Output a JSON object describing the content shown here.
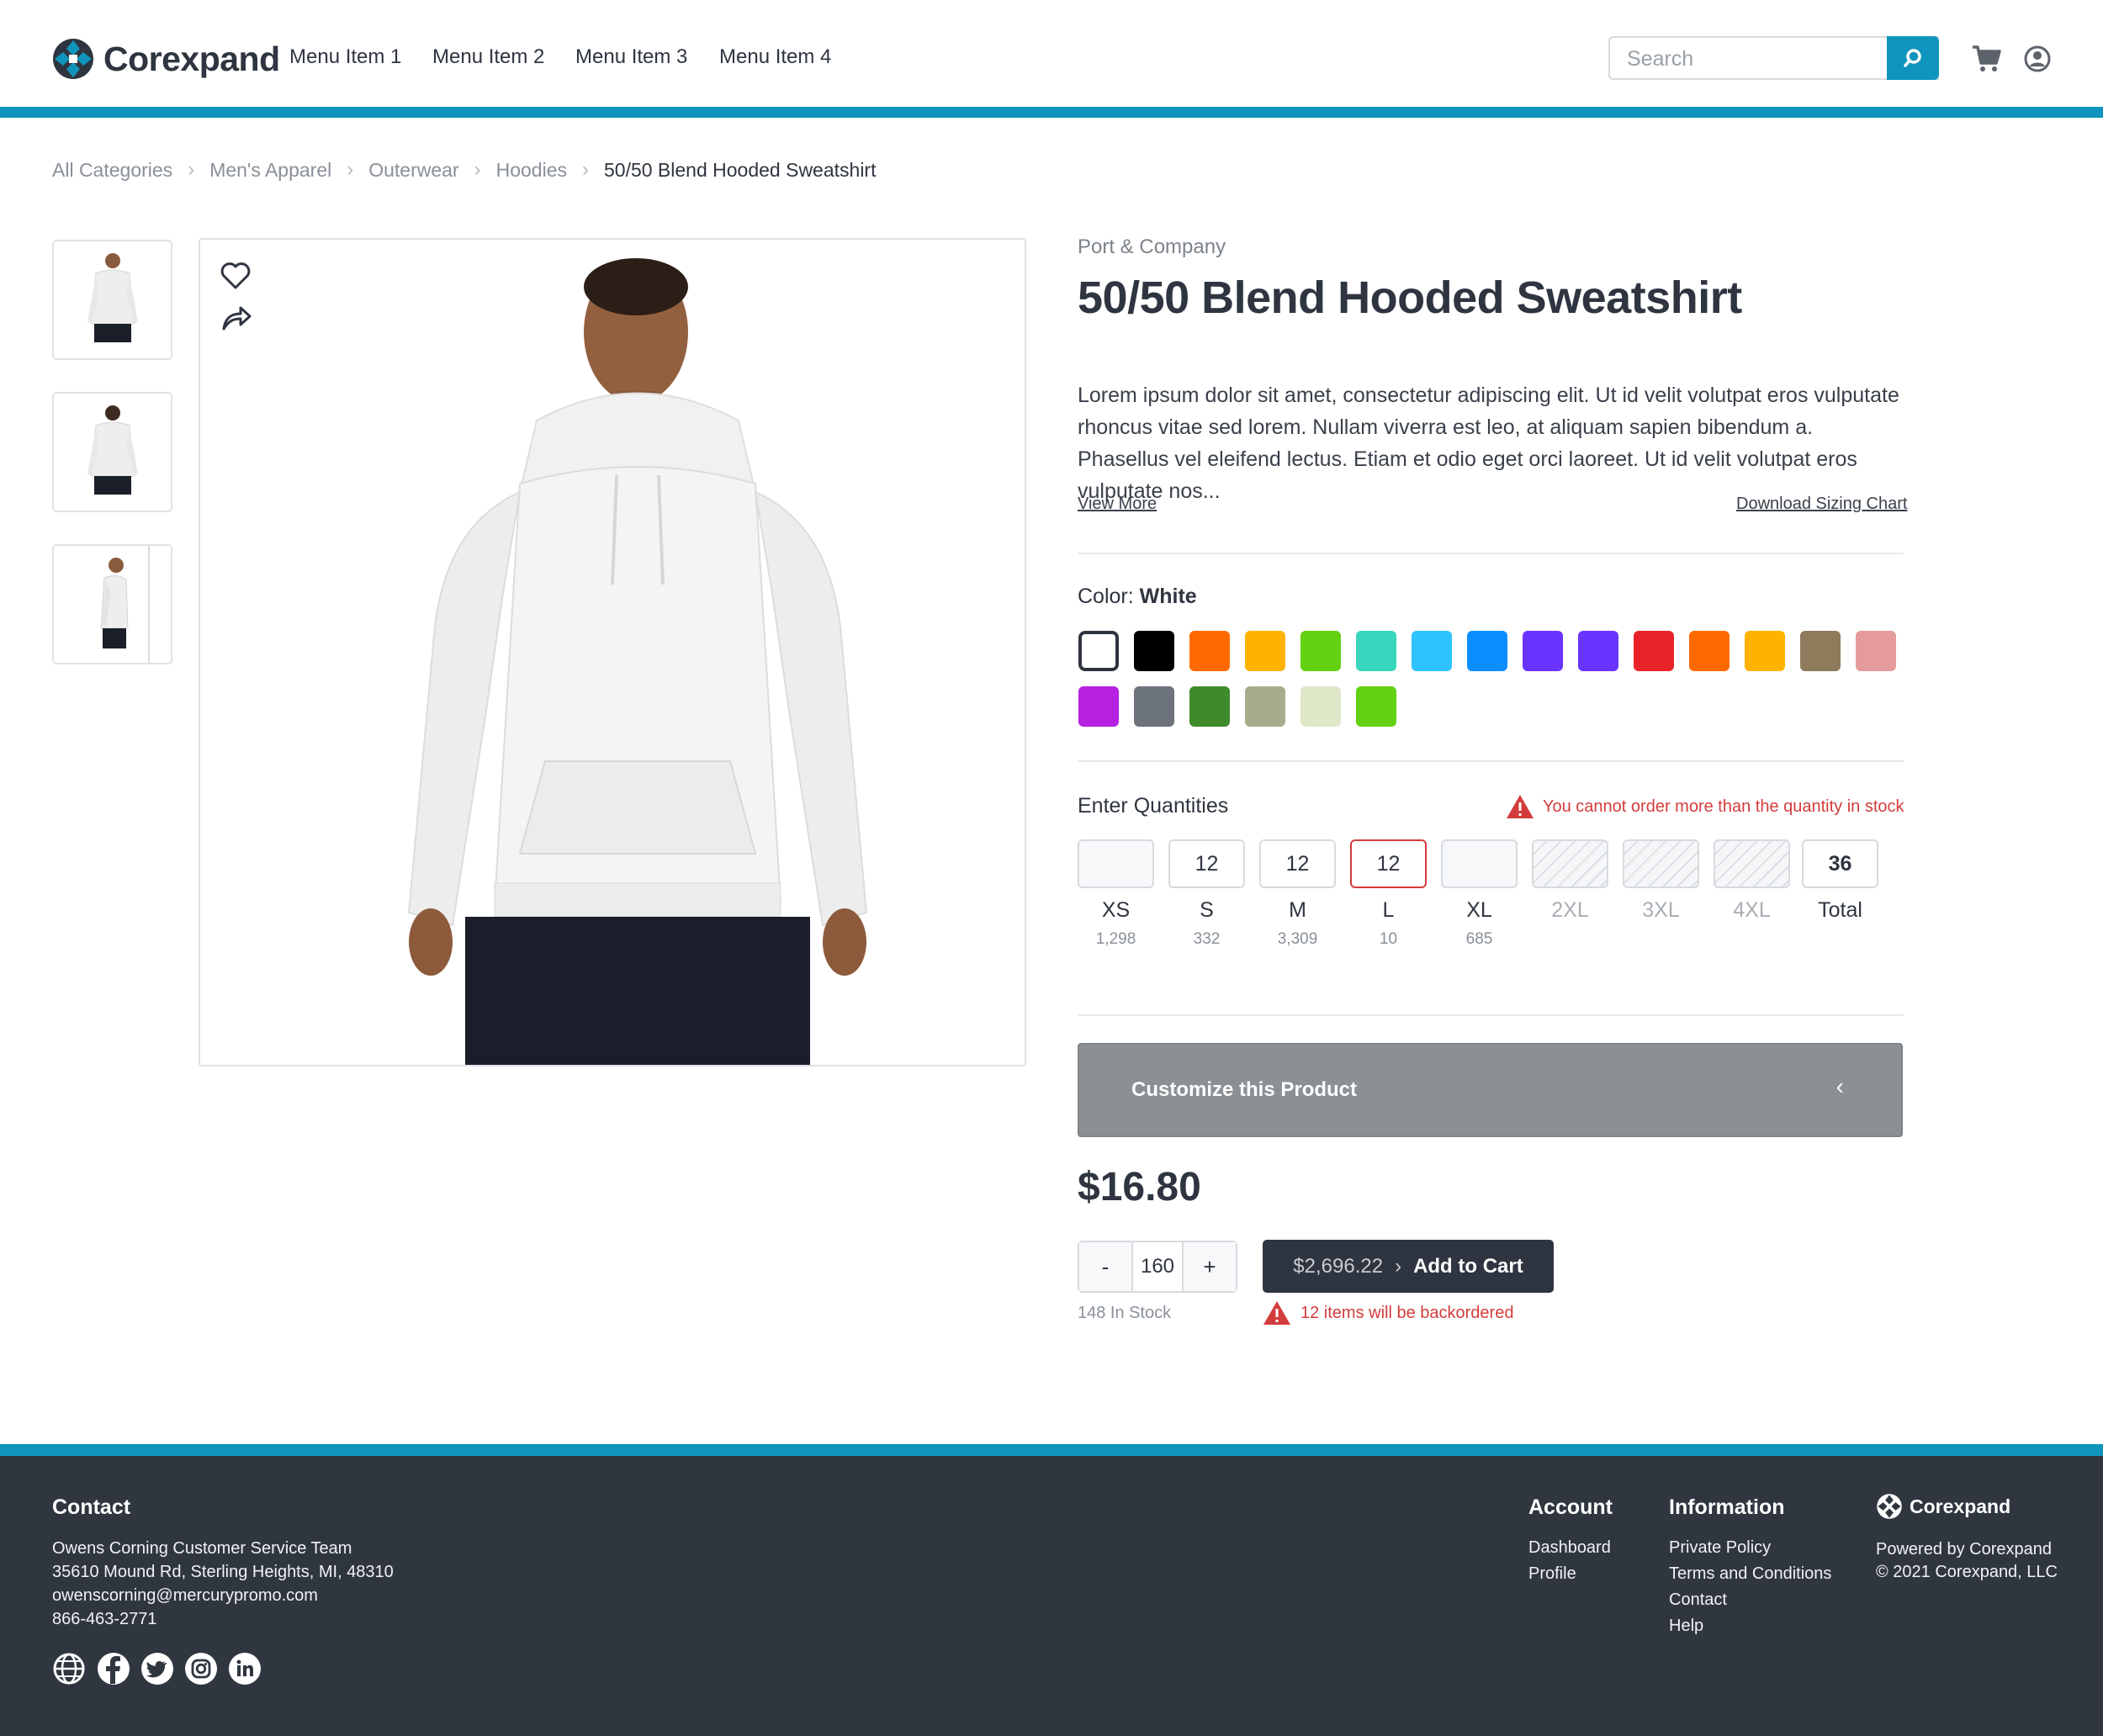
{
  "header": {
    "brand": "Corexpand",
    "menu": [
      "Menu Item 1",
      "Menu Item 2",
      "Menu Item 3",
      "Menu Item 4"
    ],
    "search_placeholder": "Search",
    "accent_color": "#0f95bd"
  },
  "breadcrumb": [
    "All Categories",
    "Men's Apparel",
    "Outerwear",
    "Hoodies",
    "50/50 Blend Hooded Sweatshirt"
  ],
  "product": {
    "brand": "Port & Company",
    "title": "50/50 Blend Hooded Sweatshirt",
    "description": "Lorem ipsum dolor sit amet, consectetur adipiscing elit. Ut id velit volutpat eros vulputate rhoncus vitae sed lorem. Nullam viverra est leo, at aliquam sapien bibendum a. Phasellus vel eleifend lectus. Etiam et odio eget orci laoreet. Ut id velit volutpat eros vulputate nos...",
    "view_more": "View More",
    "sizing_chart": "Download Sizing Chart",
    "color_label": "Color:",
    "color_value": "White",
    "swatches": [
      "#ffffff",
      "#000000",
      "#ff6a00",
      "#ffb300",
      "#63d111",
      "#38d6bd",
      "#2ec3ff",
      "#0a8eff",
      "#6a34ff",
      "#6a34ff",
      "#e8232a",
      "#ff6a00",
      "#ffb300",
      "#8e7b5c",
      "#e59b9b",
      "#b620e0",
      "#6d737b",
      "#3f8b2c",
      "#a7ad8a",
      "#dfe8c9",
      "#63d111"
    ],
    "quantities_label": "Enter Quantities",
    "quantity_warning": "You cannot order more than the quantity in stock",
    "sizes": [
      {
        "name": "XS",
        "qty": "",
        "stock": "1,298",
        "state": "empty"
      },
      {
        "name": "S",
        "qty": "12",
        "stock": "332",
        "state": "filled"
      },
      {
        "name": "M",
        "qty": "12",
        "stock": "3,309",
        "state": "filled"
      },
      {
        "name": "L",
        "qty": "12",
        "stock": "10",
        "state": "error"
      },
      {
        "name": "XL",
        "qty": "",
        "stock": "685",
        "state": "empty"
      },
      {
        "name": "2XL",
        "qty": "",
        "stock": "",
        "state": "disabled"
      },
      {
        "name": "3XL",
        "qty": "",
        "stock": "",
        "state": "disabled"
      },
      {
        "name": "4XL",
        "qty": "",
        "stock": "",
        "state": "disabled"
      }
    ],
    "total_label": "Total",
    "total_value": "36",
    "customize_label": "Customize this Product",
    "price": "$16.80",
    "stepper_minus": "-",
    "stepper_value": "160",
    "stepper_plus": "+",
    "in_stock": "148 In Stock",
    "cart_amount": "$2,696.22",
    "add_to_cart": "Add to Cart",
    "backorder_msg": "12 items will be backordered",
    "error_color": "#d33c3c"
  },
  "footer": {
    "contact_title": "Contact",
    "contact_lines": [
      "Owens Corning Customer Service Team",
      "35610 Mound Rd, Sterling Heights, MI, 48310",
      "owenscorning@mercurypromo.com",
      "866-463-2771"
    ],
    "social_icons": [
      "globe-icon",
      "facebook-icon",
      "twitter-icon",
      "instagram-icon",
      "linkedin-icon"
    ],
    "account_title": "Account",
    "account_links": [
      "Dashboard",
      "Profile"
    ],
    "info_title": "Information",
    "info_links": [
      "Private Policy",
      "Terms and Conditions",
      "Contact",
      "Help"
    ],
    "brand": "Corexpand",
    "powered_by": "Powered by Corexpand",
    "copyright": "© 2021 Corexpand, LLC"
  }
}
